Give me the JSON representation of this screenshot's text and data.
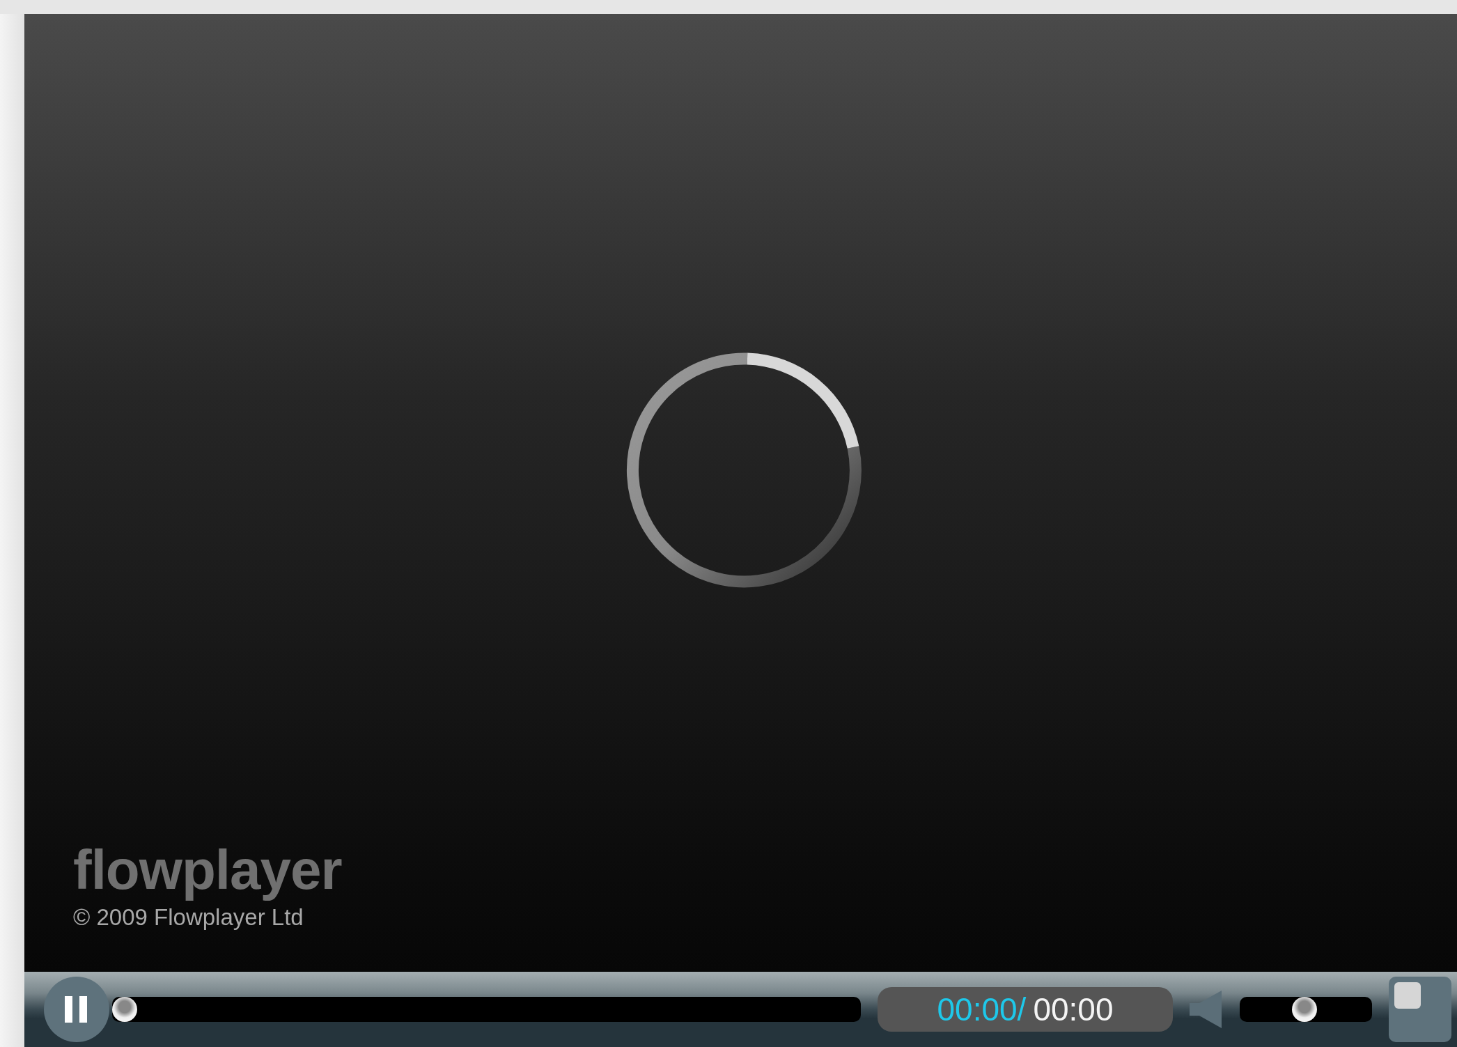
{
  "player": {
    "loading": true,
    "logo": "flowplayer",
    "copyright": "© 2009 Flowplayer Ltd"
  },
  "controls": {
    "playing": true,
    "progress": {
      "level": 0
    },
    "elapsed": "00:00/",
    "duration": "00:00",
    "muted": false,
    "volume": {
      "level": 0.5
    }
  }
}
